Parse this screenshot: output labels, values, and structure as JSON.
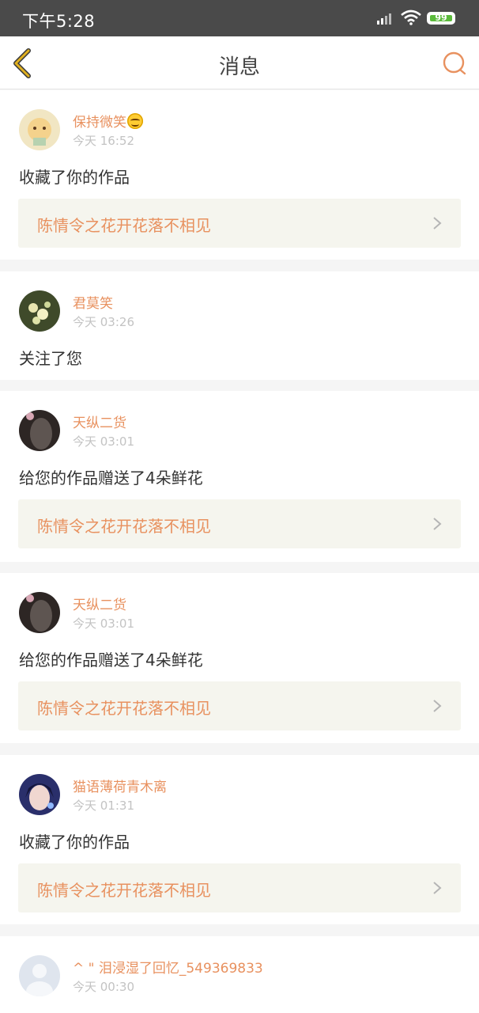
{
  "status_bar": {
    "time": "下午5:28",
    "battery": "99"
  },
  "header": {
    "title": "消息"
  },
  "messages": [
    {
      "user": "保持微笑",
      "time": "今天 16:52",
      "action": "收藏了你的作品",
      "work": "陈情令之花开花落不相见"
    },
    {
      "user": "君莫笑",
      "time": "今天 03:26",
      "action": "关注了您"
    },
    {
      "user": "天纵二货",
      "time": "今天 03:01",
      "action": "给您的作品赠送了4朵鲜花",
      "work": "陈情令之花开花落不相见"
    },
    {
      "user": "天纵二货",
      "time": "今天 03:01",
      "action": "给您的作品赠送了4朵鲜花",
      "work": "陈情令之花开花落不相见"
    },
    {
      "user": "猫语薄荷青木离",
      "time": "今天 01:31",
      "action": "收藏了你的作品",
      "work": "陈情令之花开花落不相见"
    },
    {
      "user": "^ \" 泪浸湿了回忆_549369833",
      "time": "今天 00:30"
    }
  ],
  "colors": {
    "accent": "#e8915f",
    "back_icon": "#e0b020",
    "status_bar": "#4a4a4a",
    "battery": "#5bbb3b"
  },
  "icons": {
    "back": "chevron-left-icon",
    "search": "search-icon",
    "work_link": "chevron-right-icon"
  }
}
